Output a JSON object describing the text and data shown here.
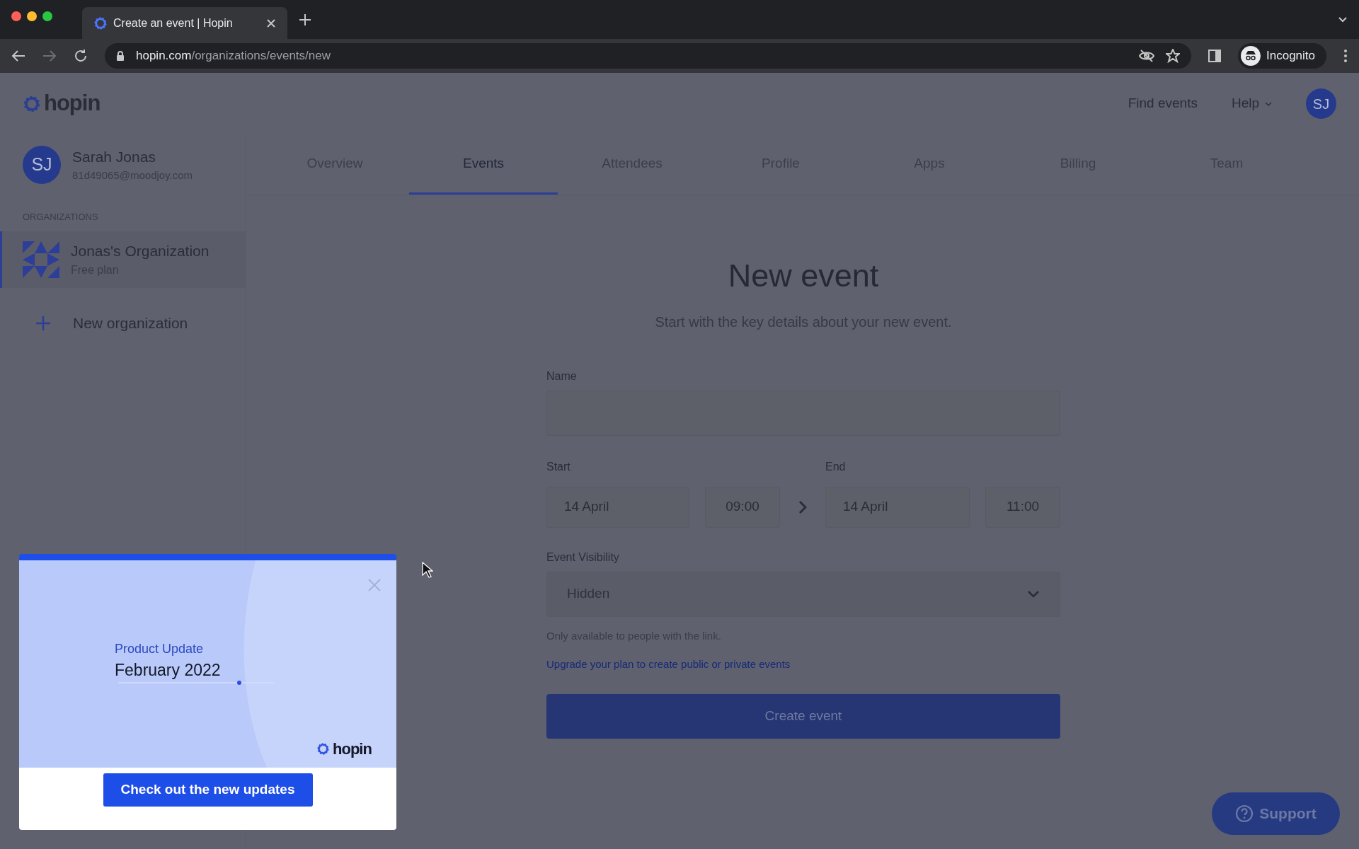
{
  "browser": {
    "tab_title": "Create an event | Hopin",
    "url_domain": "hopin.com",
    "url_path": "/organizations/events/new",
    "profile_label": "Incognito"
  },
  "header": {
    "logo": "hopin",
    "links": [
      {
        "label": "Find events",
        "kind": "link"
      },
      {
        "label": "Help",
        "kind": "dropdown"
      }
    ],
    "avatar": "SJ"
  },
  "user": {
    "initials": "SJ",
    "name": "Sarah Jonas",
    "email": "81d49065@moodjoy.com"
  },
  "tabs": [
    {
      "label": "Overview",
      "selected": false
    },
    {
      "label": "Events",
      "selected": true
    },
    {
      "label": "Attendees",
      "selected": false
    },
    {
      "label": "Profile",
      "selected": false
    },
    {
      "label": "Apps",
      "selected": false
    },
    {
      "label": "Billing",
      "selected": false
    },
    {
      "label": "Team",
      "selected": false
    }
  ],
  "sidebar": {
    "heading": "ORGANIZATIONS",
    "items": [
      {
        "kind": "org",
        "name": "Jonas's Organization",
        "plan": "Free plan",
        "selected": true
      },
      {
        "kind": "add",
        "name": "New organization",
        "selected": false
      }
    ]
  },
  "form": {
    "title": "New event",
    "subtitle": "Start with the key details about your new event.",
    "name_label": "Name",
    "start_label": "Start",
    "end_label": "End",
    "start_date": "14 April",
    "start_time": "09:00",
    "end_date": "14 April",
    "end_time": "11:00",
    "visibility_label": "Event Visibility",
    "visibility_value": "Hidden",
    "visibility_help": "Only available to people with the link.",
    "upgrade_link": "Upgrade your plan to create public or private events",
    "submit": "Create event"
  },
  "popup": {
    "kicker": "Product Update",
    "title": "February 2022",
    "logo": "hopin",
    "button": "Check out the new updates"
  },
  "support": {
    "label": "Support"
  }
}
